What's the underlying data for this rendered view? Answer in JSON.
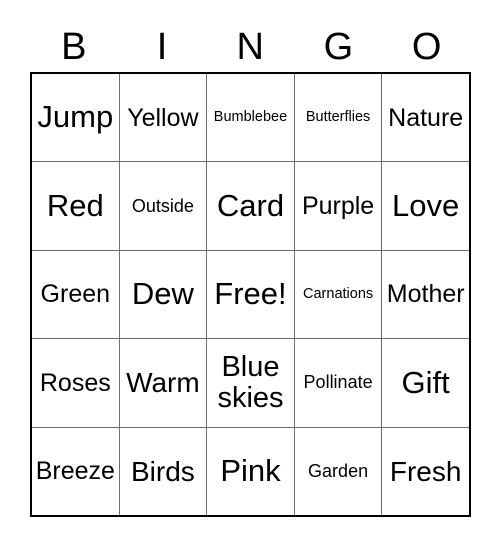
{
  "card": {
    "title": "BINGO",
    "headers": [
      "B",
      "I",
      "N",
      "G",
      "O"
    ],
    "rows": [
      {
        "cells": [
          {
            "text": "Jump",
            "size": "xl"
          },
          {
            "text": "Yellow",
            "size": "md"
          },
          {
            "text": "Bumblebee",
            "size": "xs"
          },
          {
            "text": "Butterflies",
            "size": "xs"
          },
          {
            "text": "Nature",
            "size": "md"
          }
        ]
      },
      {
        "cells": [
          {
            "text": "Red",
            "size": "xl"
          },
          {
            "text": "Outside",
            "size": "sm"
          },
          {
            "text": "Card",
            "size": "xl"
          },
          {
            "text": "Purple",
            "size": "md"
          },
          {
            "text": "Love",
            "size": "xl"
          }
        ]
      },
      {
        "cells": [
          {
            "text": "Green",
            "size": "md"
          },
          {
            "text": "Dew",
            "size": "xl"
          },
          {
            "text": "Free!",
            "size": "xl"
          },
          {
            "text": "Carnations",
            "size": "xs"
          },
          {
            "text": "Mother",
            "size": "md"
          }
        ]
      },
      {
        "cells": [
          {
            "text": "Roses",
            "size": "md"
          },
          {
            "text": "Warm",
            "size": "lg"
          },
          {
            "text": "Blue\nskies",
            "size": "wrap"
          },
          {
            "text": "Pollinate",
            "size": "sm"
          },
          {
            "text": "Gift",
            "size": "xl"
          }
        ]
      },
      {
        "cells": [
          {
            "text": "Breeze",
            "size": "md"
          },
          {
            "text": "Birds",
            "size": "lg"
          },
          {
            "text": "Pink",
            "size": "xl"
          },
          {
            "text": "Garden",
            "size": "sm"
          },
          {
            "text": "Fresh",
            "size": "lg"
          }
        ]
      }
    ],
    "colors": {
      "outer_border": "#000000",
      "inner_grid_line": "#6e6e6e",
      "text": "#000000",
      "background": "#ffffff"
    }
  }
}
